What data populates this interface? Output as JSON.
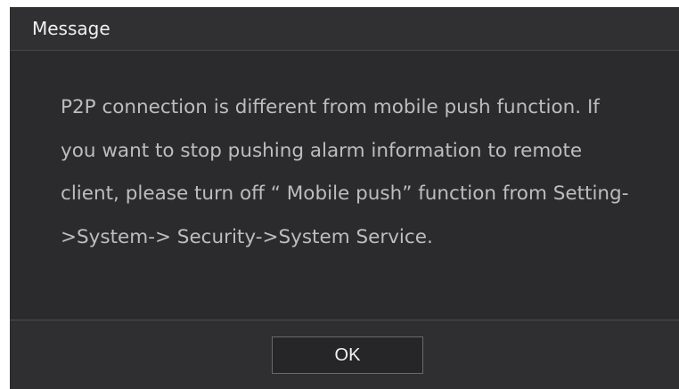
{
  "dialog": {
    "title": "Message",
    "message": "P2P connection is different from mobile push function. If you want to stop pushing alarm information to remote client, please turn off “ Mobile push” function from Setting->System-> Security->System Service.",
    "ok_label": "OK"
  },
  "colors": {
    "dialog_bg": "#2b2b2d",
    "title_text": "#f0f0f0",
    "message_text": "#bdbdbd"
  }
}
